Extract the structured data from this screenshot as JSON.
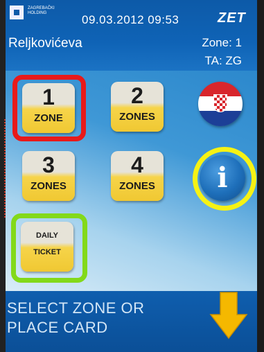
{
  "header": {
    "org_name": "ZAGREBAČKI HOLDING",
    "datetime": "09.03.2012 09:53",
    "brand": "ZET",
    "stop_name": "Reljkovićeva",
    "zone": "Zone: 1",
    "ta": "TA: ZG"
  },
  "tickets": [
    {
      "number": "1",
      "label": "ZONE"
    },
    {
      "number": "2",
      "label": "ZONES"
    },
    {
      "number": "3",
      "label": "ZONES"
    },
    {
      "number": "4",
      "label": "ZONES"
    }
  ],
  "daily_ticket": {
    "line1": "DAILY",
    "line2": "TICKET"
  },
  "buttons": {
    "language_icon": "croatian-flag-icon",
    "info_icon": "info-icon",
    "info_glyph": "i"
  },
  "prompt": {
    "line1": "SELECT ZONE OR",
    "line2": "PLACE CARD"
  },
  "colors": {
    "header_blue": "#0d5aa8",
    "button_yellow": "#f0c832",
    "highlight_red": "#e81a1a",
    "highlight_green": "#83d91a",
    "highlight_yellow": "#f6f214",
    "arrow_yellow": "#f5b800"
  }
}
